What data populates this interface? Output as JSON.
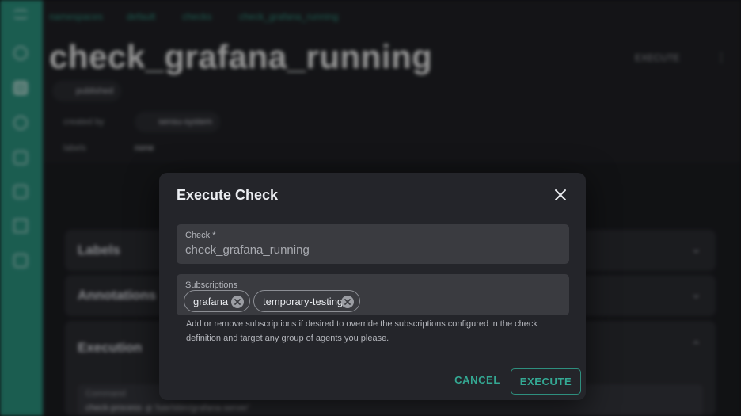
{
  "background": {
    "breadcrumbs": [
      "namespaces",
      "default",
      "checks",
      "check_grafana_running"
    ],
    "page_title": "check_grafana_running",
    "execute_label": "EXECUTE",
    "status_chip": "published",
    "created_by_label": "created by",
    "created_by_value": "sensu-system",
    "labels_label": "labels",
    "labels_value": "none",
    "panels": {
      "labels": "Labels",
      "annotations": "Annotations",
      "execution": "Execution"
    },
    "command_label": "Command",
    "command_value": "check-process -p '/usr/sbin/grafana-server'"
  },
  "dialog": {
    "title": "Execute Check",
    "check_field": {
      "label": "Check *",
      "value": "check_grafana_running"
    },
    "subscriptions_field": {
      "label": "Subscriptions",
      "tags": [
        "grafana",
        "temporary-testing"
      ]
    },
    "helper_text": "Add or remove subscriptions if desired to override the subscriptions configured in the check definition and target any group of agents you please.",
    "cancel_label": "CANCEL",
    "execute_label": "EXECUTE"
  },
  "colors": {
    "accent": "#34a893",
    "sidebar": "#2a8f7c",
    "dialog_bg": "#24252a",
    "field_bg": "#3a3b40"
  },
  "icons": [
    "menu-icon",
    "dashboard-icon",
    "entities-icon",
    "checks-icon",
    "events-icon",
    "silences-icon",
    "handlers-icon",
    "folder-icon",
    "close-icon",
    "chip-remove-icon"
  ]
}
